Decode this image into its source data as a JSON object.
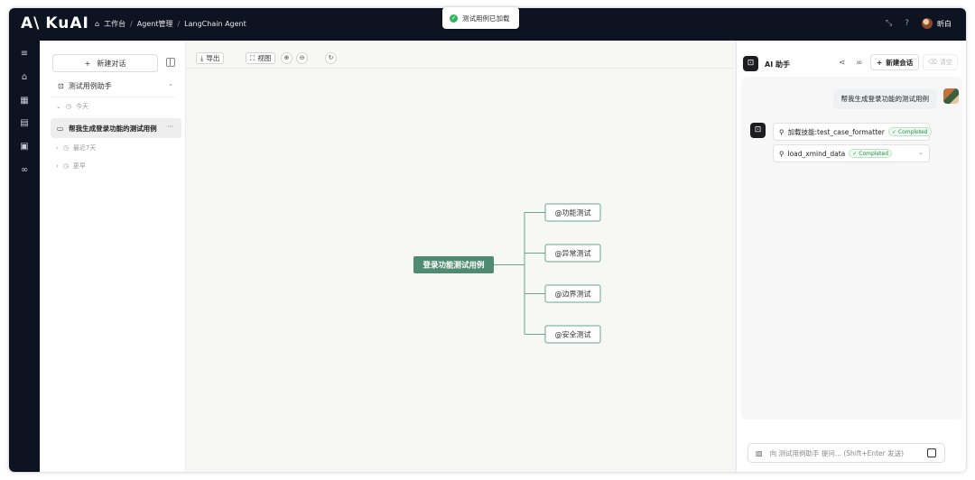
{
  "app": {
    "logo": "KuAI",
    "logo_mark": "A\\"
  },
  "breadcrumbs": [
    {
      "label": "工作台",
      "icon": "home-icon"
    },
    {
      "label": "Agent管理"
    },
    {
      "label": "LangChain Agent"
    }
  ],
  "toast": {
    "message": "测试用例已加载",
    "status_color": "#2fb45a"
  },
  "user": {
    "name": "昕白"
  },
  "sidebar": {
    "new_chat": "新建对话",
    "assistant": "测试用例助手",
    "groups": {
      "today": "今天",
      "last7": "最近7天",
      "earlier": "更早"
    },
    "active_conversation": "帮我生成登录功能的测试用例",
    "more": "···"
  },
  "toolbar": {
    "export": "导出",
    "view": "视图"
  },
  "mindmap": {
    "root": "登录功能测试用例",
    "children": [
      "@功能测试",
      "@异常测试",
      "@边界测试",
      "@安全测试"
    ],
    "root_color": "#4e8a74",
    "border_color": "#6aa58c"
  },
  "panel": {
    "title": "AI 助手",
    "new_session": "新建会话",
    "clear": "清空",
    "user_message": "帮我生成登录功能的测试用例",
    "tools": [
      {
        "name": "加载技能:test_case_formatter",
        "status": "Completed"
      },
      {
        "name": "load_xmind_data",
        "status": "Completed"
      }
    ],
    "composer_placeholder": "向 测试用例助手 提问... (Shift+Enter 发送)"
  },
  "colors": {
    "topbar": "#0d1321",
    "accent_green": "#2fb45a"
  }
}
